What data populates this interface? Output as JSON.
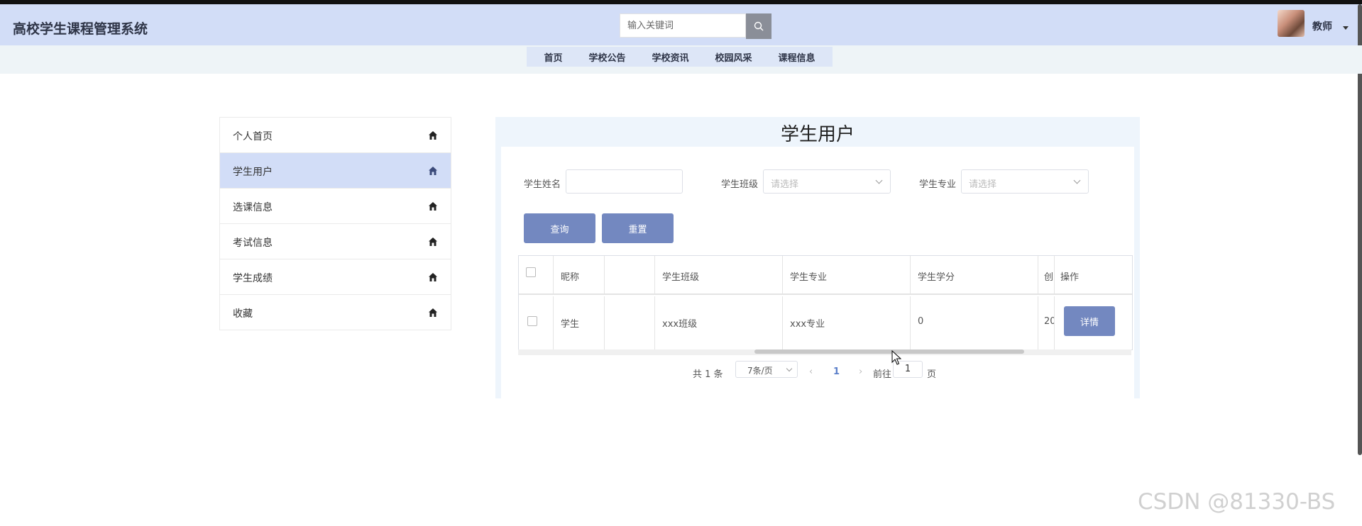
{
  "app": {
    "title": "高校学生课程管理系统"
  },
  "header": {
    "search_placeholder": "输入关键词",
    "search_icon": "search-icon",
    "user_label": "教师"
  },
  "nav": {
    "items": [
      "首页",
      "学校公告",
      "学校资讯",
      "校园风采",
      "课程信息"
    ]
  },
  "sidebar": {
    "items": [
      {
        "label": "个人首页",
        "icon": "home-icon"
      },
      {
        "label": "学生用户",
        "icon": "home-icon",
        "active": true
      },
      {
        "label": "选课信息",
        "icon": "home-icon"
      },
      {
        "label": "考试信息",
        "icon": "home-icon"
      },
      {
        "label": "学生成绩",
        "icon": "home-icon"
      },
      {
        "label": "收藏",
        "icon": "home-icon"
      }
    ]
  },
  "main": {
    "title": "学生用户",
    "filters": {
      "name_label": "学生姓名",
      "name_value": "",
      "class_label": "学生班级",
      "class_placeholder": "请选择",
      "major_label": "学生专业",
      "major_placeholder": "请选择"
    },
    "buttons": {
      "query": "查询",
      "reset": "重置"
    },
    "table": {
      "columns": [
        "昵称",
        "学生班级",
        "学生专业",
        "学生学分",
        "创",
        "操作"
      ],
      "rows": [
        {
          "nickname": "学生",
          "class": "xxx班级",
          "major": "xxx专业",
          "credits": "0",
          "created_partial": "20",
          "action": "详情"
        }
      ]
    },
    "pagination": {
      "total_text": "共 1 条",
      "page_size": "7条/页",
      "current_page": "1",
      "goto_label": "前往",
      "goto_value": "1",
      "page_suffix": "页"
    }
  },
  "watermark": "CSDN @81330-BS",
  "colors": {
    "header_bg": "#d2ddf7",
    "accent_button": "#7388c0",
    "active_sidebar": "#d2ddf7",
    "panel_bg": "#eef5fc"
  }
}
